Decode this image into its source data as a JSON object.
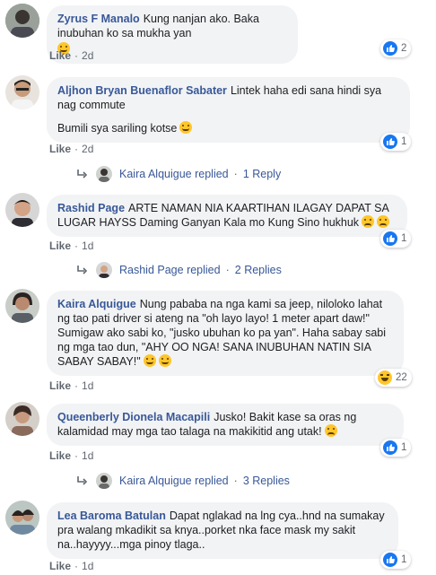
{
  "like_label": "Like",
  "dot": "·",
  "accent": "#385898",
  "comments": [
    {
      "author": "Zyrus F Manalo",
      "text": [
        "Kung nanjan ako. Baka inubuhan ko sa mukha yan"
      ],
      "reaction_count": "2",
      "reaction_type": "like",
      "age": "2d"
    },
    {
      "author": "Aljhon Bryan Buenaflor Sabater",
      "text": [
        "Lintek haha edi sana hindi sya nag commute",
        "Bumili sya sariling kotse"
      ],
      "reaction_count": "1",
      "reaction_type": "like",
      "age": "2d",
      "replies": {
        "name": "Kaira Alquigue",
        "verb": "replied",
        "count": "1 Reply"
      }
    },
    {
      "author": "Rashid Page",
      "text": [
        "ARTE NAMAN NIA KAARTIHAN ILAGAY DAPAT SA LUGAR HAYSS Daming Ganyan Kala mo Kung Sino hukhuk"
      ],
      "reaction_count": "1",
      "reaction_type": "like",
      "age": "1d",
      "replies": {
        "name": "Rashid Page",
        "verb": "replied",
        "count": "2 Replies"
      }
    },
    {
      "author": "Kaira Alquigue",
      "text": [
        "Nung pababa na nga kami sa jeep, niloloko lahat ng tao pati driver si ateng na \"oh layo layo! 1 meter apart daw!\" Sumigaw ako sabi ko, \"jusko ubuhan ko pa yan\". Haha sabay sabi ng mga tao dun, \"AHY OO NGA! SANA INUBUHAN NATIN SIA SABAY SABAY!\""
      ],
      "reaction_count": "22",
      "reaction_type": "haha",
      "age": "1d"
    },
    {
      "author": "Queenberly Dionela Macapili",
      "text": [
        "Jusko! Bakit kase sa oras ng kalamidad may mga tao talaga na makikitid ang utak!"
      ],
      "reaction_count": "1",
      "reaction_type": "like",
      "age": "1d",
      "replies": {
        "name": "Kaira Alquigue",
        "verb": "replied",
        "count": "3 Replies"
      }
    },
    {
      "author": "Lea Baroma Batulan",
      "text": [
        "Dapat nglakad na lng cya..hnd na sumakay pra walang mkadikit sa knya..porket nka face mask my sakit na..hayyyy...mga pinoy tlaga.."
      ],
      "reaction_count": "1",
      "reaction_type": "like",
      "age": "1d"
    }
  ]
}
